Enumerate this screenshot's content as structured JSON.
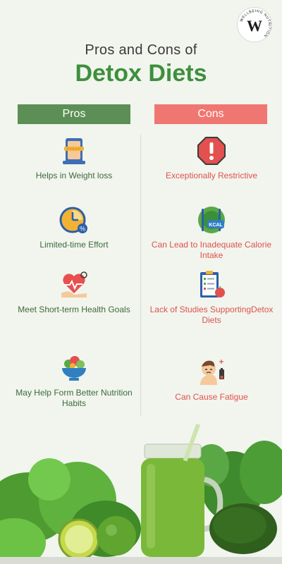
{
  "brand": {
    "ring_text": "WELLBEING NUTRITION",
    "letter": "W"
  },
  "title": {
    "line1": "Pros and Cons of",
    "line2": "Detox Diets"
  },
  "columns": {
    "pros_label": "Pros",
    "cons_label": "Cons"
  },
  "pros": [
    {
      "icon": "weight-loss-icon",
      "label": "Helps in Weight loss"
    },
    {
      "icon": "clock-icon",
      "label": "Limited-time Effort"
    },
    {
      "icon": "heart-health-icon",
      "label": "Meet Short-term Health Goals"
    },
    {
      "icon": "salad-bowl-icon",
      "label": "May Help Form Better Nutrition Habits"
    }
  ],
  "cons": [
    {
      "icon": "stop-warning-icon",
      "label": "Exceptionally Restrictive"
    },
    {
      "icon": "kcal-plate-icon",
      "label": "Can Lead to Inadequate Calorie Intake"
    },
    {
      "icon": "clipboard-checklist-icon",
      "label": "Lack of Studies SupportingDetox Diets"
    },
    {
      "icon": "fatigue-icon",
      "label": "Can Cause Fatigue"
    }
  ],
  "icon_labels": {
    "kcal": "KCAL"
  },
  "colors": {
    "background": "#f1f5ee",
    "pros_header": "#5c8f55",
    "cons_header": "#f07671",
    "title_green": "#3f8f3c",
    "pros_text": "#3e6a39",
    "cons_text": "#e0514c"
  }
}
